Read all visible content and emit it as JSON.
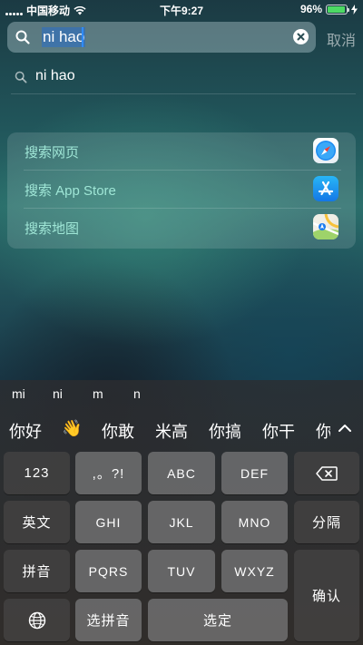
{
  "status_bar": {
    "carrier": "中国移动",
    "time": "下午9:27",
    "battery": "96%",
    "battery_level": 0.96
  },
  "search": {
    "query": "ni hao",
    "cancel_label": "取消"
  },
  "suggestion": {
    "text": "ni hao"
  },
  "actions": [
    {
      "label": "搜索网页",
      "icon": "safari-icon"
    },
    {
      "label": "搜索 App Store",
      "icon": "app-store-icon"
    },
    {
      "label": "搜索地图",
      "icon": "maps-icon"
    }
  ],
  "keyboard": {
    "pinyin_options": [
      "mi",
      "ni",
      "m",
      "n"
    ],
    "candidates": [
      "你好",
      "👋",
      "你敢",
      "米高",
      "你搞",
      "你干",
      "你"
    ],
    "keys": {
      "num": "123",
      "punct": ",。?!",
      "abc": "ABC",
      "def": "DEF",
      "english": "英文",
      "ghi": "GHI",
      "jkl": "JKL",
      "mno": "MNO",
      "separate": "分隔",
      "pinyin": "拼音",
      "pqrs": "PQRS",
      "tuv": "TUV",
      "wxyz": "WXYZ",
      "confirm": "确认",
      "select_pinyin": "选拼音",
      "select": "选定"
    }
  },
  "colors": {
    "action_text": "#9fe6d6",
    "battery_fill": "#4cd964",
    "caret": "#2f8cff"
  }
}
